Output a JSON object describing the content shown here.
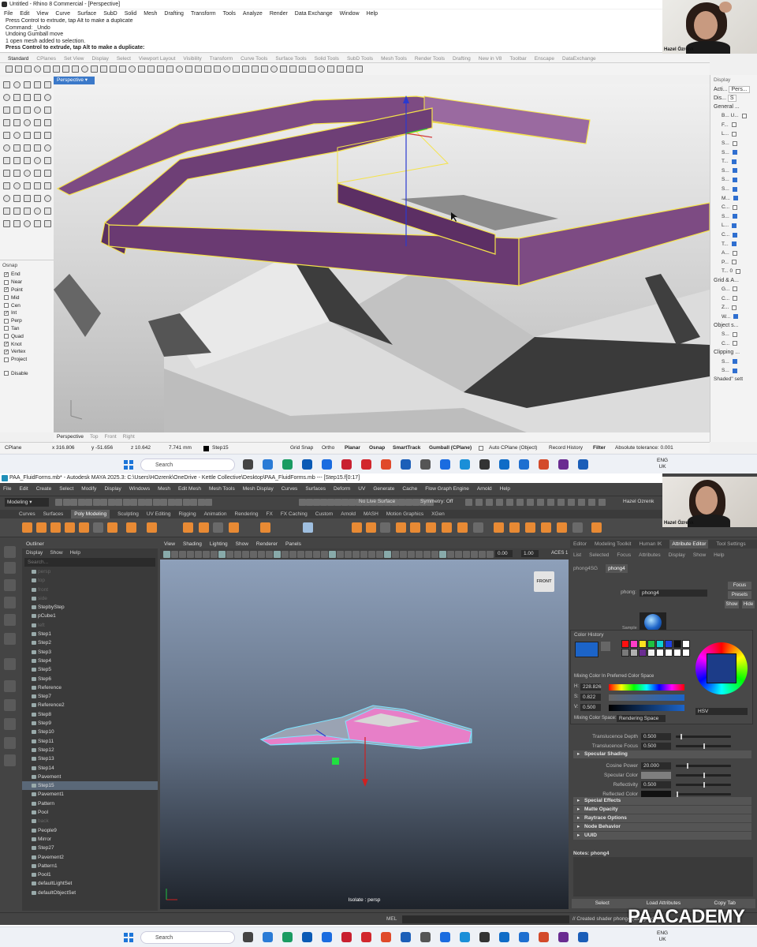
{
  "rhino": {
    "title": "Untitled - Rhino 8 Commercial - [Perspective]",
    "menu": [
      "File",
      "Edit",
      "View",
      "Curve",
      "Surface",
      "SubD",
      "Solid",
      "Mesh",
      "Drafting",
      "Transform",
      "Tools",
      "Analyze",
      "Render",
      "Data Exchange",
      "Window",
      "Help"
    ],
    "history": [
      "Press Control to extrude, tap Alt to make a duplicate",
      "Command: _Undo",
      "Undoing Gumball move",
      "1 open mesh added to selection."
    ],
    "prompt": "Press Control to extrude, tap Alt to make a duplicate:",
    "tabs": [
      "Standard",
      "CPlanes",
      "Set View",
      "Display",
      "Select",
      "Viewport Layout",
      "Visibility",
      "Transform",
      "Curve Tools",
      "Surface Tools",
      "Solid Tools",
      "SubD Tools",
      "Mesh Tools",
      "Render Tools",
      "Drafting",
      "New in V8",
      "Toolbar",
      "Enscape",
      "DataExchange"
    ],
    "viewport_label": "Perspective",
    "osnap": {
      "title": "Osnap",
      "items": [
        {
          "label": "End",
          "checked": true
        },
        {
          "label": "Near",
          "checked": false
        },
        {
          "label": "Point",
          "checked": true
        },
        {
          "label": "Mid",
          "checked": false
        },
        {
          "label": "Cen",
          "checked": false
        },
        {
          "label": "Int",
          "checked": true
        },
        {
          "label": "Perp",
          "checked": false
        },
        {
          "label": "Tan",
          "checked": false
        },
        {
          "label": "Quad",
          "checked": false
        },
        {
          "label": "Knot",
          "checked": true
        },
        {
          "label": "Vertex",
          "checked": true
        },
        {
          "label": "Project",
          "checked": false
        }
      ],
      "disable": "Disable"
    },
    "display_panel": {
      "title": "Display",
      "top1": "Acti...",
      "top2": "Pers...",
      "dis": "Dis...",
      "s": "S",
      "general": "General ...",
      "rows": [
        "B... U...",
        "F...",
        "L...",
        "S...",
        "S...",
        "T...",
        "S...",
        "S...",
        "S...",
        "M...",
        "C...",
        "S...",
        "L...",
        "C...",
        "T...",
        "A...",
        "P...",
        "T... 0"
      ],
      "grid": "Grid & A...",
      "grid_rows": [
        "G...",
        "C...",
        "Z...",
        "W..."
      ],
      "object": "Object s...",
      "object_rows": [
        "S...",
        "C..."
      ],
      "clipping": "Clipping ...",
      "clip_rows": [
        "S...",
        "S..."
      ],
      "footer": "Shaded\" sett"
    },
    "bottom_tabs": [
      "Perspective",
      "Top",
      "Front",
      "Right"
    ],
    "status": {
      "cplane": "CPlane",
      "x": "x 316.806",
      "y": "y -51.656",
      "z": "z 10.642",
      "dist": "7.741 mm",
      "layer": "Step15",
      "grid_snap": "Grid Snap",
      "ortho": "Ortho",
      "planar": "Planar",
      "osnap": "Osnap",
      "smarttrack": "SmartTrack",
      "gumball": "Gumball (CPlane)",
      "autocplane": "Auto CPlane (Object)",
      "record": "Record History",
      "filter": "Filter",
      "tolerance": "Absolute tolerance: 0.001"
    },
    "presenter": "Hazel Özrenk"
  },
  "taskbar": {
    "search": "Search",
    "lang1": "ENG",
    "lang2": "UK"
  },
  "maya": {
    "title": "PAA_FluidForms.mb* - Autodesk MAYA 2025.3: C:\\Users\\HOzrenk\\OneDrive - Kettle Collective\\Desktop\\PAA_FluidForms.mb  ---  [Step15.f[0:17]",
    "menu": [
      "File",
      "Edit",
      "Create",
      "Select",
      "Modify",
      "Display",
      "Windows",
      "Mesh",
      "Edit Mesh",
      "Mesh Tools",
      "Mesh Display",
      "Curves",
      "Surfaces",
      "Deform",
      "UV",
      "Generate",
      "Cache",
      "Flow Graph Engine",
      "Arnold",
      "Help"
    ],
    "mode": "Modeling",
    "no_live": "No Live Surface",
    "symmetry": "Symmetry: Off",
    "user": "Hazel Ozrenk",
    "workspace": "Workspa",
    "shelf_tabs": [
      "Curves",
      "Surfaces",
      "Poly Modeling",
      "Sculpting",
      "UV Editing",
      "Rigging",
      "Animation",
      "Rendering",
      "FX",
      "FX Caching",
      "Custom",
      "Arnold",
      "MASH",
      "Motion Graphics",
      "XGen"
    ],
    "outliner": {
      "title": "Outliner",
      "menu": [
        "Display",
        "Show",
        "Help"
      ],
      "search": "Search...",
      "items": [
        {
          "label": "persp",
          "dim": true
        },
        {
          "label": "top",
          "dim": true
        },
        {
          "label": "front",
          "dim": true
        },
        {
          "label": "side",
          "dim": true
        },
        {
          "label": "StepbyStep"
        },
        {
          "label": "pCube1"
        },
        {
          "label": "left",
          "dim": true
        },
        {
          "label": "Step1"
        },
        {
          "label": "Step2"
        },
        {
          "label": "Step3"
        },
        {
          "label": "Step4"
        },
        {
          "label": "Step5"
        },
        {
          "label": "Step6"
        },
        {
          "label": "Reference"
        },
        {
          "label": "Step7"
        },
        {
          "label": "Reference2"
        },
        {
          "label": "Step8"
        },
        {
          "label": "Step9"
        },
        {
          "label": "Step10"
        },
        {
          "label": "Step11"
        },
        {
          "label": "Step12"
        },
        {
          "label": "Step13"
        },
        {
          "label": "Step14"
        },
        {
          "label": "Pavement"
        },
        {
          "label": "Step15",
          "selected": true
        },
        {
          "label": "Pavement1"
        },
        {
          "label": "Pattern"
        },
        {
          "label": "Pool"
        },
        {
          "label": "back",
          "dim": true
        },
        {
          "label": "People9"
        },
        {
          "label": "Mirror"
        },
        {
          "label": "Step27"
        },
        {
          "label": "Pavement2"
        },
        {
          "label": "Pattern1"
        },
        {
          "label": "Pool1"
        },
        {
          "label": "defaultLightSet"
        },
        {
          "label": "defaultObjectSet"
        }
      ]
    },
    "viewport_menu": [
      "View",
      "Shading",
      "Lighting",
      "Show",
      "Renderer",
      "Panels"
    ],
    "vp_val1": "0.00",
    "vp_val2": "1.00",
    "vp_aces": "ACES 1",
    "view_cube": "FRONT",
    "isolate": "Isolate : persp",
    "attr": {
      "tabs": [
        "Editor",
        "Modeling Toolkit",
        "Human IK",
        "Attribute Editor",
        "Tool Settings"
      ],
      "menu": [
        "List",
        "Selected",
        "Focus",
        "Attributes",
        "Display",
        "Show",
        "Help"
      ],
      "node_tabs": [
        "phong4SG",
        "phong4"
      ],
      "phong_label": "phong:",
      "phong_value": "phong4",
      "focus": "Focus",
      "presets": "Presets",
      "show": "Show",
      "hide": "Hide",
      "sample": "Sample",
      "color_history": "Color History",
      "mixing_label": "Mixing Color In Preferred Color Space",
      "h_label": "H:",
      "h": "228.826",
      "s_label": "S:",
      "s": "0.822",
      "v_label": "V:",
      "v": "0.500",
      "mixing_space_label": "Mixing Color Space:",
      "mixing_space": "Rendering Space",
      "hsv": "HSV",
      "translucence_depth": "Translucence Depth",
      "td_value": "0.500",
      "translucence_focus": "Translucence Focus",
      "tf_value": "0.500",
      "specular_shading": "Specular Shading",
      "cosine_power": "Cosine Power",
      "cp_value": "20.000",
      "specular_color": "Specular Color",
      "reflectivity": "Reflectivity",
      "r_value": "0.500",
      "reflected_color": "Reflected Color",
      "sections": [
        "Special Effects",
        "Matte Opacity",
        "Raytrace Options",
        "Node Behavior",
        "UUID"
      ],
      "notes": "Notes: phong4",
      "select": "Select",
      "load_attributes": "Load Attributes",
      "copy_tab": "Copy Tab"
    },
    "mel": "MEL",
    "feedback": "// Created shader phong4 (assigned",
    "presenter": "Hazel Özrenk",
    "watermark": "PAACADEMY",
    "colors": {
      "accent_purple": "#7d4b83",
      "wire_yellow": "#f5e34a",
      "swatch_blue": "#1c64c8",
      "maya_orange": "#e88a34",
      "pink": "#e77fc8"
    }
  }
}
